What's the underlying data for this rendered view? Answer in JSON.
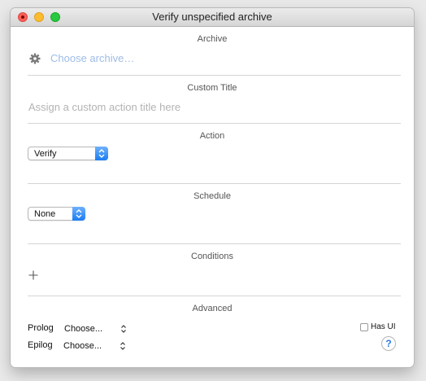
{
  "window": {
    "title": "Verify unspecified archive"
  },
  "archive": {
    "heading": "Archive",
    "icon": "gear-icon",
    "choose_label": "Choose archive…"
  },
  "custom_title": {
    "heading": "Custom Title",
    "placeholder": "Assign a custom action title here",
    "value": ""
  },
  "action": {
    "heading": "Action",
    "selected": "Verify"
  },
  "schedule": {
    "heading": "Schedule",
    "selected": "None"
  },
  "conditions": {
    "heading": "Conditions",
    "add_icon": "plus-icon"
  },
  "advanced": {
    "heading": "Advanced",
    "prolog_label": "Prolog",
    "prolog_value": "Choose...",
    "epilog_label": "Epilog",
    "epilog_value": "Choose...",
    "has_ui_label": "Has UI",
    "has_ui_checked": false,
    "help_label": "?"
  },
  "colors": {
    "accent": "#1b7cf3",
    "link_placeholder": "#9ebce6",
    "close": "#fc5f57",
    "minimize": "#fdbc2e",
    "maximize": "#28c840"
  }
}
